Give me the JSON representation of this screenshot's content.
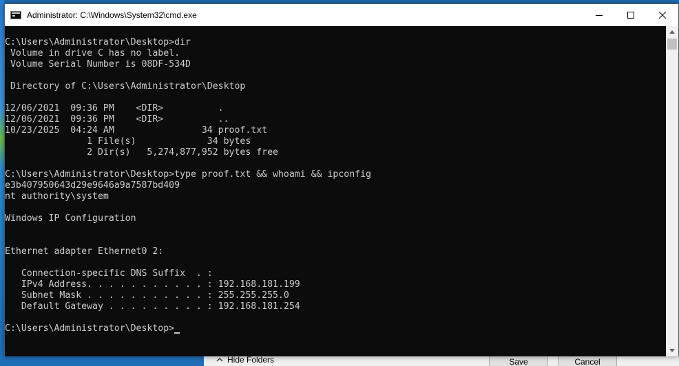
{
  "window": {
    "title": "Administrator: C:\\Windows\\System32\\cmd.exe"
  },
  "console": {
    "lines": [
      "C:\\Users\\Administrator\\Desktop>dir",
      " Volume in drive C has no label.",
      " Volume Serial Number is 08DF-534D",
      "",
      " Directory of C:\\Users\\Administrator\\Desktop",
      "",
      "12/06/2021  09:36 PM    <DIR>          .",
      "12/06/2021  09:36 PM    <DIR>          ..",
      "10/23/2025  04:24 AM                34 proof.txt",
      "               1 File(s)             34 bytes",
      "               2 Dir(s)   5,274,877,952 bytes free",
      "",
      "C:\\Users\\Administrator\\Desktop>type proof.txt && whoami && ipconfig",
      "e3b407950643d29e9646a9a7587bd409",
      "nt authority\\system",
      "",
      "Windows IP Configuration",
      "",
      "",
      "Ethernet adapter Ethernet0 2:",
      "",
      "   Connection-specific DNS Suffix  . :",
      "   IPv4 Address. . . . . . . . . . . : 192.168.181.199",
      "   Subnet Mask . . . . . . . . . . . : 255.255.255.0",
      "   Default Gateway . . . . . . . . . : 192.168.181.254",
      ""
    ],
    "prompt": "C:\\Users\\Administrator\\Desktop>"
  },
  "background_dialog": {
    "hide_folders_label": "Hide Folders",
    "save_label": "Save",
    "cancel_label": "Cancel"
  },
  "icons": {
    "app": "cmd-icon",
    "minimize": "minimize-icon",
    "maximize": "maximize-icon",
    "close": "close-icon"
  },
  "colors": {
    "console_bg": "#0c0c0c",
    "console_fg": "#cccccc",
    "titlebar_bg": "#ffffff"
  }
}
